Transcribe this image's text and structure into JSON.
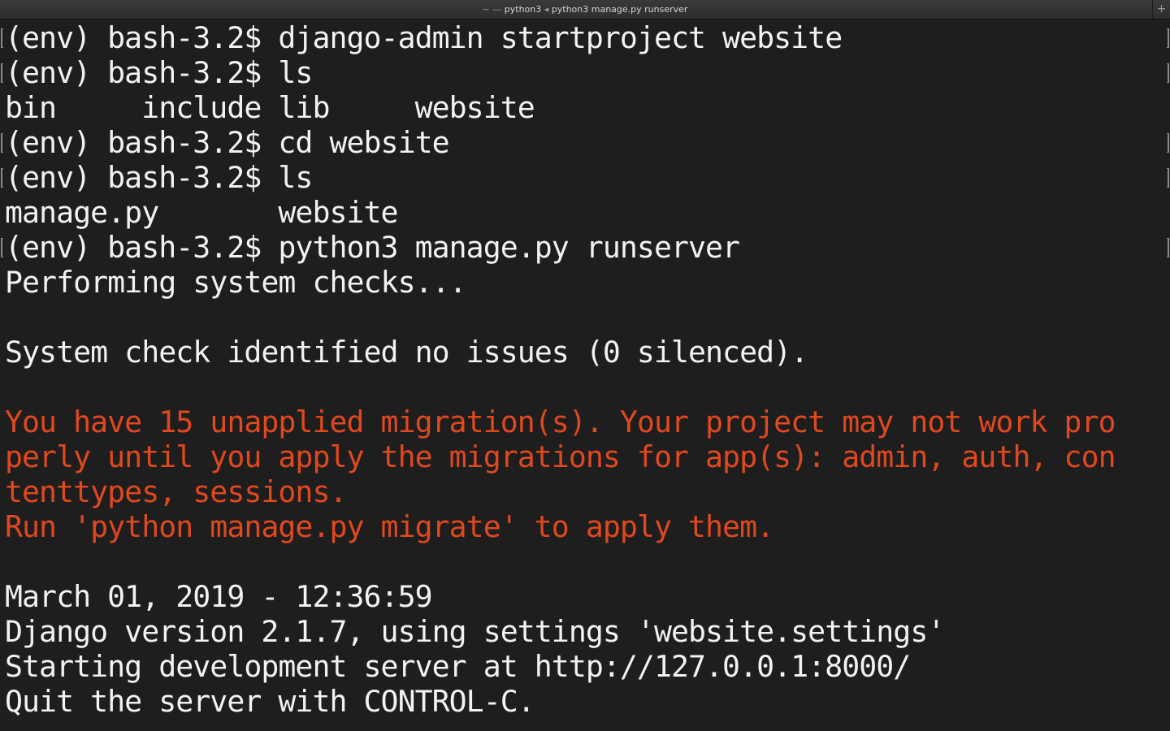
{
  "window": {
    "title_prefix": "~ — ",
    "title_app": "python3",
    "title_sep": " ◂ ",
    "title_cmd": "python3 manage.py runserver",
    "new_tab_glyph": "+"
  },
  "terminal": {
    "text_color": "#f2f2f2",
    "warning_color": "#e0481e",
    "lines": [
      "(env) bash-3.2$ django-admin startproject website",
      "(env) bash-3.2$ ls",
      "bin     include lib     website",
      "(env) bash-3.2$ cd website",
      "(env) bash-3.2$ ls",
      "manage.py       website",
      "(env) bash-3.2$ python3 manage.py runserver",
      "Performing system checks...",
      "",
      "System check identified no issues (0 silenced).",
      "",
      "You have 15 unapplied migration(s). Your project may not work pro",
      "perly until you apply the migrations for app(s): admin, auth, con",
      "tenttypes, sessions.",
      "Run 'python manage.py migrate' to apply them.",
      "",
      "March 01, 2019 - 12:36:59",
      "Django version 2.1.7, using settings 'website.settings'",
      "Starting development server at http://127.0.0.1:8000/",
      "Quit the server with CONTROL-C."
    ]
  }
}
